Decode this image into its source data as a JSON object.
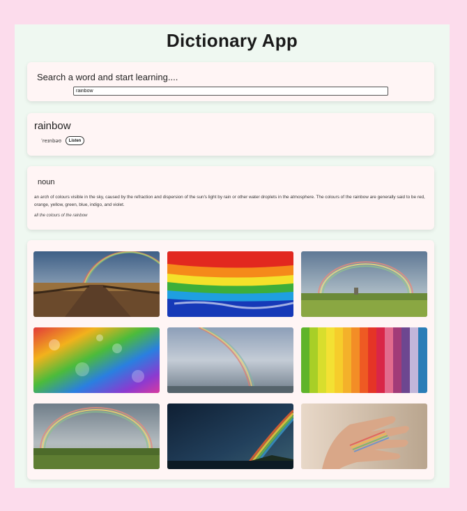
{
  "app": {
    "title": "Dictionary App"
  },
  "search": {
    "heading": "Search a word and start learning....",
    "value": "rainbow"
  },
  "word": {
    "text": "rainbow",
    "phonetic": "ˈreɪnbəʊ",
    "listen_label": "Listen"
  },
  "definition": {
    "part_of_speech": "noun",
    "text": "an arch of colours visible in the sky, caused by the refraction and dispersion of the sun's light by rain or other water droplets in the atmosphere. The colours of the rainbow are generally said to be red, orange, yellow, green, blue, indigo, and violet.",
    "example": "all the colours of the rainbow"
  },
  "images": [
    {
      "subject": "rainbow over wooden boardwalk"
    },
    {
      "subject": "rainbow colored paint layers"
    },
    {
      "subject": "rainbow over green field"
    },
    {
      "subject": "rainbow glitter"
    },
    {
      "subject": "rainbow in grey sky"
    },
    {
      "subject": "rainbow paper strips"
    },
    {
      "subject": "double rainbow over meadow"
    },
    {
      "subject": "rainbow over dark sea"
    },
    {
      "subject": "rainbow light on hand"
    }
  ]
}
